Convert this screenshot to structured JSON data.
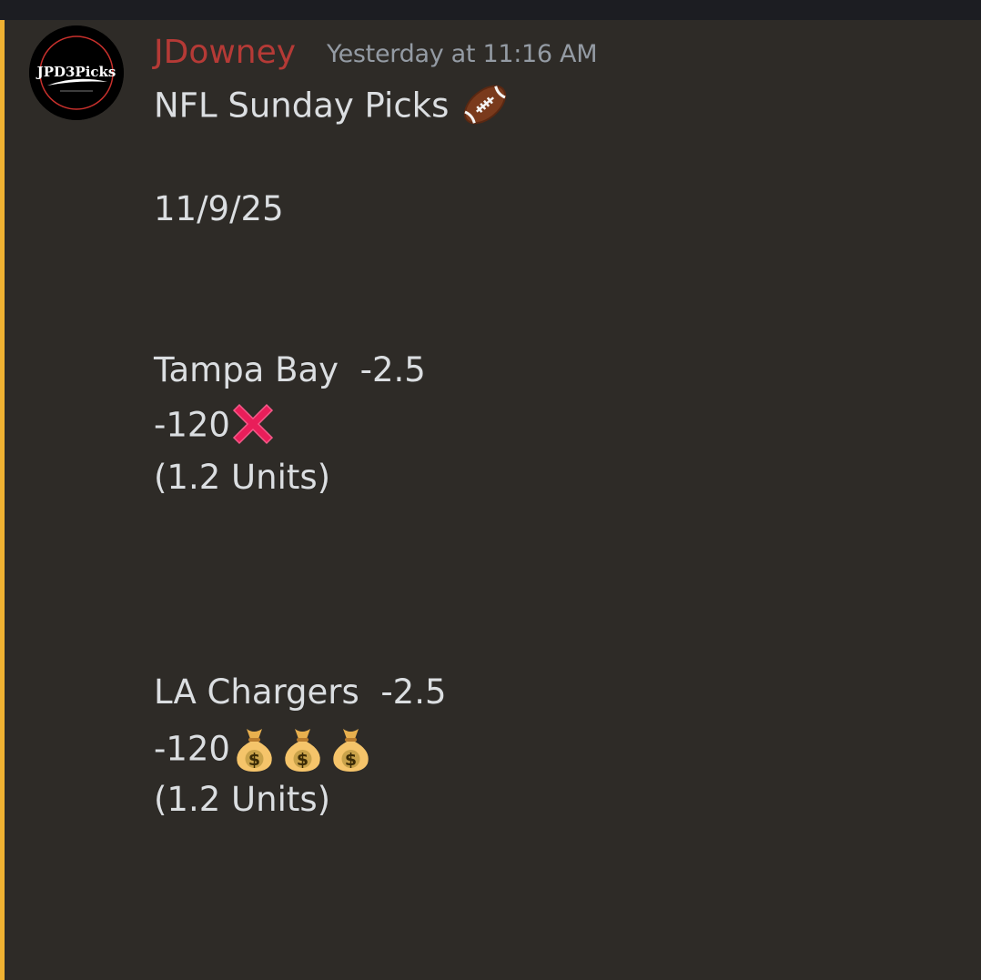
{
  "window": {
    "accent_color": "#f0b232",
    "background_color": "#2e2b27"
  },
  "message": {
    "avatar": {
      "logo_text": "JPD3Picks",
      "icon": "jpd3picks-logo-icon"
    },
    "author": "JDowney",
    "author_color": "#b53a36",
    "timestamp": "Yesterday at 11:16 AM",
    "lines": {
      "title": "NFL Sunday Picks",
      "date": "11/9/25",
      "pick1_team": "Tampa Bay  -2.5",
      "pick1_odds": "-120",
      "pick1_units": "(1.2 Units)",
      "pick2_team": "LA Chargers  -2.5",
      "pick2_odds": "-120",
      "pick2_units": "(1.2 Units)"
    },
    "emojis": {
      "title": "american-football-icon",
      "pick1_result": "cross-mark-icon",
      "pick2_result": [
        "money-bag-icon",
        "money-bag-icon",
        "money-bag-icon"
      ]
    }
  }
}
